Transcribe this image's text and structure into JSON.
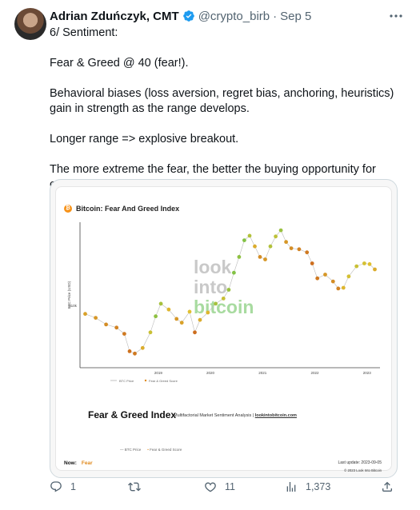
{
  "tweet": {
    "author_name": "Adrian Zduńczyk, CMT",
    "handle": "@crypto_birb",
    "separator": "·",
    "date": "Sep 5",
    "more_icon": "more-horizontal-icon",
    "verified_color": "#1d9bf0",
    "paragraphs": [
      "6/ Sentiment:",
      "Fear & Greed @ 40 (fear!).",
      "Behavioral biases (loss aversion, regret bias, anchoring, heuristics) gain in strength as the range develops.",
      "Longer range => explosive breakout.",
      "The more extreme the fear, the better the buying opportunity for contrarians."
    ]
  },
  "media": {
    "chart_title": "Bitcoin: Fear And Greed Index",
    "watermark": [
      "look",
      "into",
      "bitcoin"
    ],
    "fg_title": "Fear & Greed Index",
    "fg_subtitle_prefix": "Multifactorial Market Sentiment Analysis |",
    "fg_subtitle_link": "lookintobitcoin.com",
    "legend_items": [
      "BTC Price",
      "Fear & Greed Score"
    ],
    "now_label": "Now:",
    "now_value": "Fear",
    "last_update": "Last update: 2023-09-05",
    "copyright": "© 2023 Look Into Bitcoin",
    "colors": {
      "fear": "#e08a1e",
      "greed": "#6cc24a",
      "btc_icon": "#f7931a"
    },
    "chart_data": {
      "type": "line",
      "title": "Bitcoin: Fear And Greed Index",
      "ylabel": "BTC Price (USD)",
      "ytick_labels": [
        "$10k"
      ],
      "xtick_labels": [
        "2019",
        "2020",
        "2021",
        "2022",
        "2023"
      ],
      "series": [
        {
          "name": "BTC Price",
          "x": [
            2018.1,
            2018.3,
            2018.5,
            2018.7,
            2018.85,
            2018.95,
            2019.05,
            2019.2,
            2019.35,
            2019.45,
            2019.55,
            2019.7,
            2019.85,
            2019.95,
            2020.1,
            2020.2,
            2020.3,
            2020.45,
            2020.6,
            2020.75,
            2020.85,
            2020.95,
            2021.05,
            2021.15,
            2021.25,
            2021.35,
            2021.45,
            2021.55,
            2021.65,
            2021.75,
            2021.85,
            2021.95,
            2022.05,
            2022.2,
            2022.35,
            2022.45,
            2022.55,
            2022.7,
            2022.85,
            2022.95,
            2023.05,
            2023.15,
            2023.3,
            2023.45,
            2023.55,
            2023.65
          ],
          "values": [
            9000,
            8200,
            7000,
            6500,
            5600,
            3700,
            3500,
            4000,
            5800,
            8500,
            11500,
            10000,
            8000,
            7300,
            9500,
            5800,
            7800,
            9300,
            11500,
            13000,
            16000,
            24000,
            35000,
            52000,
            58000,
            45000,
            35000,
            33000,
            45000,
            57000,
            66000,
            50000,
            43000,
            42000,
            39000,
            30000,
            21000,
            23000,
            19500,
            16500,
            16800,
            22000,
            28000,
            30000,
            29500,
            26000
          ]
        },
        {
          "name": "Fear & Greed Score",
          "x": [
            2018.1,
            2018.3,
            2018.5,
            2018.7,
            2018.85,
            2018.95,
            2019.05,
            2019.2,
            2019.35,
            2019.45,
            2019.55,
            2019.7,
            2019.85,
            2019.95,
            2020.1,
            2020.2,
            2020.3,
            2020.45,
            2020.6,
            2020.75,
            2020.85,
            2020.95,
            2021.05,
            2021.15,
            2021.25,
            2021.35,
            2021.45,
            2021.55,
            2021.65,
            2021.75,
            2021.85,
            2021.95,
            2022.05,
            2022.2,
            2022.35,
            2022.45,
            2022.55,
            2022.7,
            2022.85,
            2022.95,
            2023.05,
            2023.15,
            2023.3,
            2023.45,
            2023.55,
            2023.65
          ],
          "values": [
            35,
            30,
            25,
            20,
            15,
            12,
            15,
            40,
            60,
            85,
            75,
            45,
            30,
            35,
            50,
            10,
            40,
            45,
            75,
            60,
            80,
            90,
            85,
            90,
            70,
            40,
            25,
            30,
            70,
            65,
            80,
            30,
            25,
            20,
            15,
            10,
            15,
            30,
            25,
            20,
            45,
            55,
            60,
            55,
            50,
            40
          ]
        }
      ]
    }
  },
  "actions": {
    "reply_count": "1",
    "retweet_count": "",
    "like_count": "11",
    "views_count": "1,373"
  }
}
